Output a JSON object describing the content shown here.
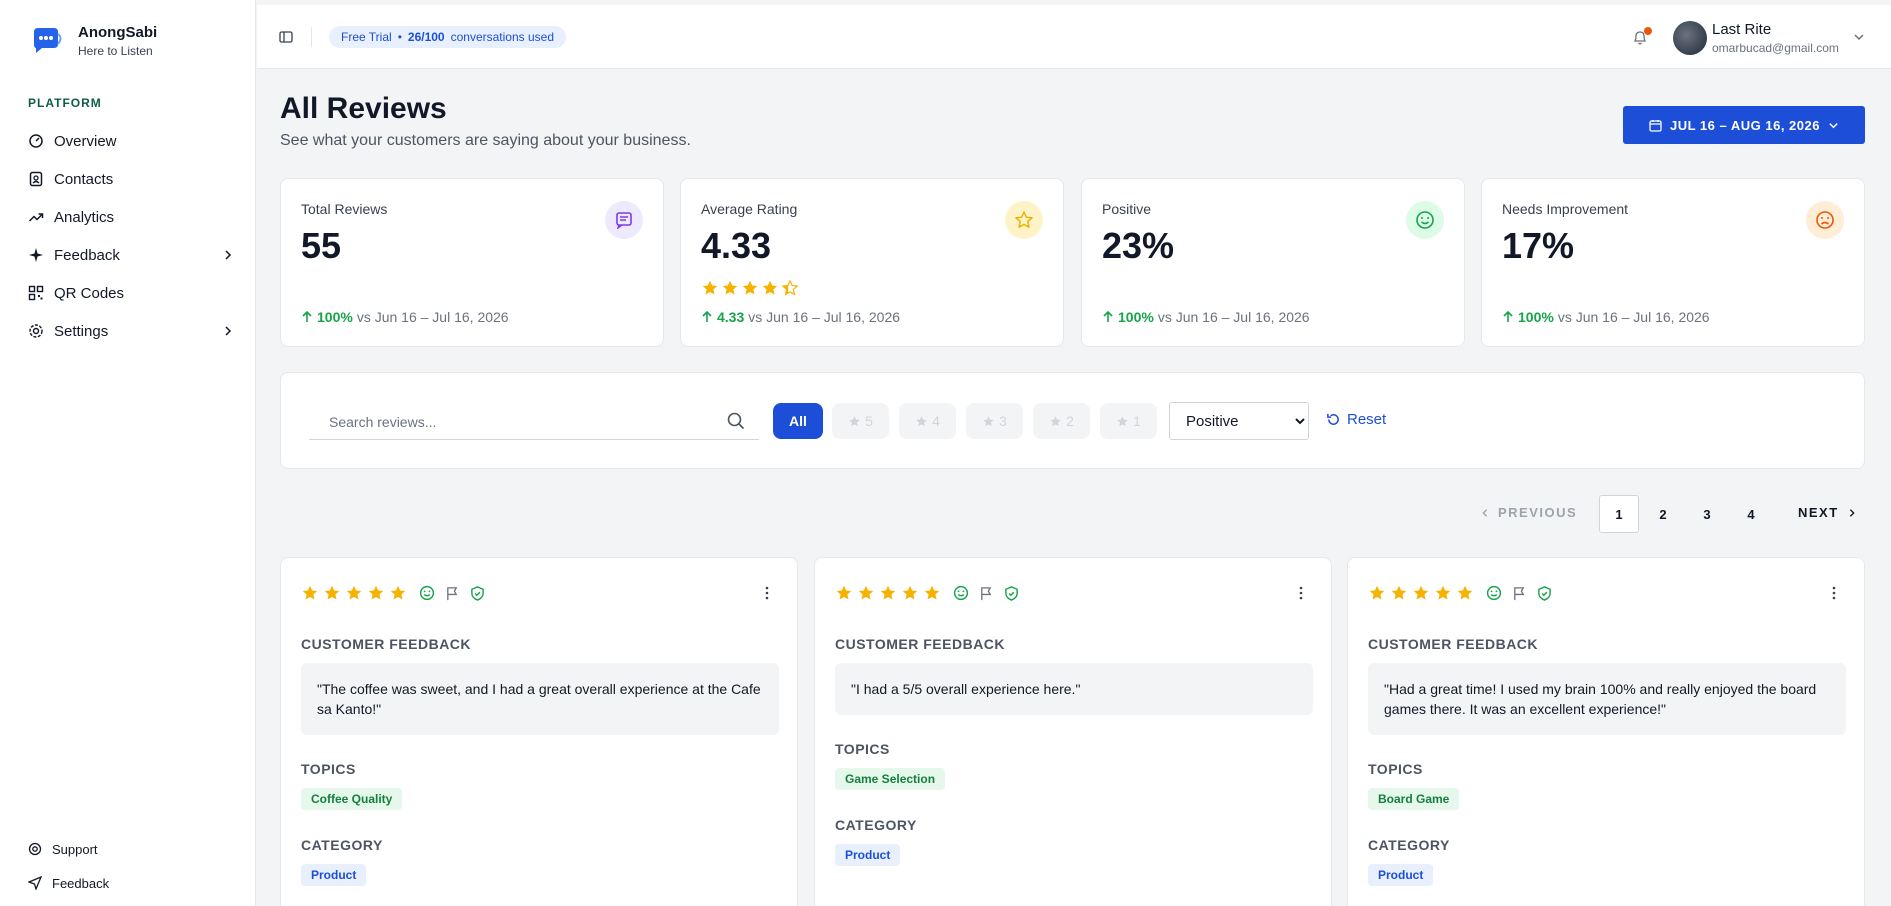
{
  "brand": {
    "name": "AnongSabi",
    "tagline": "Here to Listen"
  },
  "sidebar": {
    "section": "PLATFORM",
    "items": [
      {
        "label": "Overview"
      },
      {
        "label": "Contacts"
      },
      {
        "label": "Analytics"
      },
      {
        "label": "Feedback"
      },
      {
        "label": "QR Codes"
      },
      {
        "label": "Settings"
      }
    ],
    "bottom": [
      {
        "label": "Support"
      },
      {
        "label": "Feedback"
      }
    ]
  },
  "topbar": {
    "trial_label": "Free Trial",
    "trial_sep": "•",
    "trial_count": "26/100",
    "trial_suffix": "conversations used",
    "user_name": "Last Rite",
    "user_email": "omarbucad@gmail.com"
  },
  "header": {
    "title": "All Reviews",
    "subtitle": "See what your customers are saying about your business.",
    "date_range": "JUL 16 – AUG 16, 2026"
  },
  "stats": [
    {
      "label": "Total Reviews",
      "value": "55",
      "delta": "100%",
      "compare": "vs Jun 16 – Jul 16, 2026",
      "icon": "message-icon",
      "icon_bg": "#ede9fe",
      "icon_color": "#7c3aed"
    },
    {
      "label": "Average Rating",
      "value": "4.33",
      "delta": "4.33",
      "compare": "vs Jun 16 – Jul 16, 2026",
      "icon": "star-icon",
      "icon_bg": "#fef3c7",
      "icon_color": "#eab308",
      "rating": 4.33
    },
    {
      "label": "Positive",
      "value": "23%",
      "delta": "100%",
      "compare": "vs Jun 16 – Jul 16, 2026",
      "icon": "smile-icon",
      "icon_bg": "#dcfce7",
      "icon_color": "#16a34a"
    },
    {
      "label": "Needs Improvement",
      "value": "17%",
      "delta": "100%",
      "compare": "vs Jun 16 – Jul 16, 2026",
      "icon": "frown-icon",
      "icon_bg": "#ffedd5",
      "icon_color": "#ea580c"
    }
  ],
  "filters": {
    "search_placeholder": "Search reviews...",
    "all_label": "All",
    "star_pills": [
      "5",
      "4",
      "3",
      "2",
      "1"
    ],
    "sentiment_selected": "Positive",
    "reset_label": "Reset"
  },
  "pagination": {
    "prev_label": "PREVIOUS",
    "next_label": "NEXT",
    "pages": [
      "1",
      "2",
      "3",
      "4"
    ],
    "current": "1"
  },
  "reviews": [
    {
      "rating": 5,
      "feedback_heading": "CUSTOMER FEEDBACK",
      "quote": "\"The coffee was sweet, and I had a great overall experience at the Cafe sa Kanto!\"",
      "topics_heading": "TOPICS",
      "topic": "Coffee Quality",
      "category_heading": "CATEGORY",
      "category": "Product"
    },
    {
      "rating": 5,
      "feedback_heading": "CUSTOMER FEEDBACK",
      "quote": "\"I had a 5/5 overall experience here.\"",
      "topics_heading": "TOPICS",
      "topic": "Game Selection",
      "category_heading": "CATEGORY",
      "category": "Product"
    },
    {
      "rating": 5,
      "feedback_heading": "CUSTOMER FEEDBACK",
      "quote": "\"Had a great time! I used my brain 100% and really enjoyed the board games there. It was an excellent experience!\"",
      "topics_heading": "TOPICS",
      "topic": "Board Game",
      "category_heading": "CATEGORY",
      "category": "Product"
    }
  ],
  "colors": {
    "accent": "#1d4ed8",
    "star": "#f5b300",
    "positive": "#16a34a"
  }
}
